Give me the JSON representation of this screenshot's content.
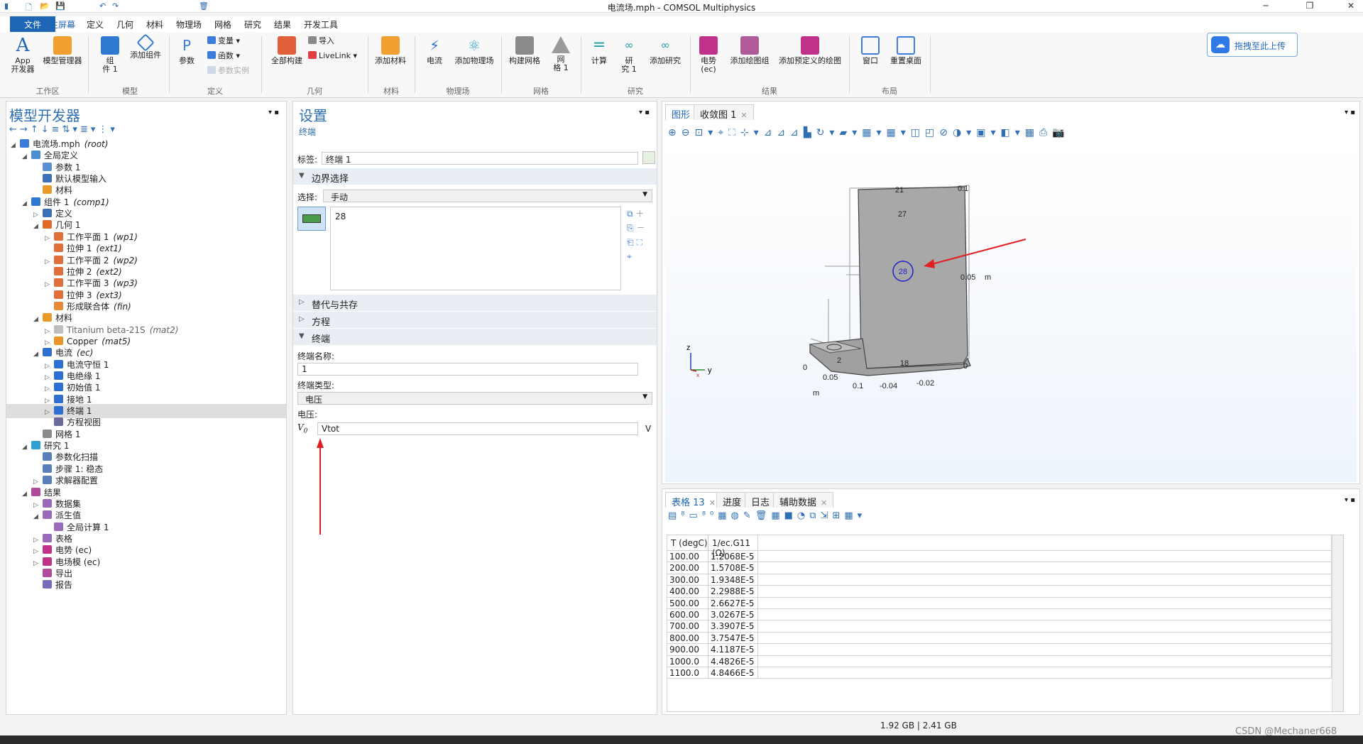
{
  "window": {
    "title": "电流场.mph - COMSOL Multiphysics"
  },
  "menubar": {
    "file": "文件",
    "items": [
      "主屏幕",
      "定义",
      "几何",
      "材料",
      "物理场",
      "网格",
      "研究",
      "结果",
      "开发工具"
    ]
  },
  "ribbon": {
    "app_dev": "App\n开发器",
    "app_dev_l1": "App",
    "app_dev_l2": "开发器",
    "model_mgr": "模型管理器",
    "component": "组",
    "component_l2": "件 1",
    "add_component": "添加组件",
    "parameters": "参数",
    "variables": "变量",
    "functions": "函数",
    "param_instance": "参数实例",
    "build_all": "全部构建",
    "import": "导入",
    "livelink": "LiveLink",
    "add_material": "添加材料",
    "current": "电流",
    "add_physics": "添加物理场",
    "build_mesh": "构建网格",
    "mesh": "网",
    "mesh_l2": "格 1",
    "compute": "计算",
    "study": "研",
    "study_l2": "究 1",
    "add_study": "添加研究",
    "potential": "电势",
    "potential_l2": "(ec)",
    "add_plot_group": "添加绘图组",
    "add_predef_plot": "添加预定义的绘图",
    "window": "窗口",
    "reset_desktop": "重置桌面",
    "groups": [
      "工作区",
      "模型",
      "定义",
      "几何",
      "材料",
      "物理场",
      "网格",
      "研究",
      "结果",
      "布局"
    ],
    "upload": "拖拽至此上传",
    "help": "?"
  },
  "model_builder": {
    "title": "模型开发器",
    "tree": [
      {
        "label": "电流场.mph",
        "tag": "(root)",
        "level": 0,
        "arrow": "◢",
        "color": "#3b7dd8"
      },
      {
        "label": "全局定义",
        "tag": "",
        "level": 1,
        "arrow": "◢",
        "color": "#4a8fd4"
      },
      {
        "label": "参数 1",
        "tag": "",
        "level": 2,
        "arrow": "",
        "color": "#5b8fd0"
      },
      {
        "label": "默认模型输入",
        "tag": "",
        "level": 2,
        "arrow": "",
        "color": "#3f6fb8"
      },
      {
        "label": "材料",
        "tag": "",
        "level": 2,
        "arrow": "",
        "color": "#e89a2a"
      },
      {
        "label": "组件 1",
        "tag": "(comp1)",
        "level": 1,
        "arrow": "◢",
        "color": "#2f7ad0"
      },
      {
        "label": "定义",
        "tag": "",
        "level": 2,
        "arrow": "▷",
        "color": "#3b6fb8"
      },
      {
        "label": "几何 1",
        "tag": "",
        "level": 2,
        "arrow": "◢",
        "color": "#e06a2a"
      },
      {
        "label": "工作平面 1",
        "tag": "(wp1)",
        "level": 3,
        "arrow": "▷",
        "color": "#e0703a"
      },
      {
        "label": "拉伸 1",
        "tag": "(ext1)",
        "level": 3,
        "arrow": "",
        "color": "#e0703a"
      },
      {
        "label": "工作平面 2",
        "tag": "(wp2)",
        "level": 3,
        "arrow": "▷",
        "color": "#e0703a"
      },
      {
        "label": "拉伸 2",
        "tag": "(ext2)",
        "level": 3,
        "arrow": "",
        "color": "#e0703a"
      },
      {
        "label": "工作平面 3",
        "tag": "(wp3)",
        "level": 3,
        "arrow": "▷",
        "color": "#e0703a"
      },
      {
        "label": "拉伸 3",
        "tag": "(ext3)",
        "level": 3,
        "arrow": "",
        "color": "#e0703a"
      },
      {
        "label": "形成联合体",
        "tag": "(fin)",
        "level": 3,
        "arrow": "",
        "color": "#e88a3a"
      },
      {
        "label": "材料",
        "tag": "",
        "level": 2,
        "arrow": "◢",
        "color": "#e89a2a"
      },
      {
        "label": "Titanium beta-21S",
        "tag": "(mat2)",
        "level": 3,
        "arrow": "▷",
        "color": "#bdbdbd",
        "gray": true
      },
      {
        "label": "Copper",
        "tag": "(mat5)",
        "level": 3,
        "arrow": "▷",
        "color": "#e8962a"
      },
      {
        "label": "电流",
        "tag": "(ec)",
        "level": 2,
        "arrow": "◢",
        "color": "#2f6fd0"
      },
      {
        "label": "电流守恒 1",
        "tag": "",
        "level": 3,
        "arrow": "▷",
        "color": "#2f6fd0"
      },
      {
        "label": "电绝缘 1",
        "tag": "",
        "level": 3,
        "arrow": "▷",
        "color": "#2f6fd0"
      },
      {
        "label": "初始值 1",
        "tag": "",
        "level": 3,
        "arrow": "▷",
        "color": "#2f6fd0"
      },
      {
        "label": "接地 1",
        "tag": "",
        "level": 3,
        "arrow": "▷",
        "color": "#2f6fd0"
      },
      {
        "label": "终端 1",
        "tag": "",
        "level": 3,
        "arrow": "▷",
        "color": "#2f6fd0",
        "selected": true
      },
      {
        "label": "方程视图",
        "tag": "",
        "level": 3,
        "arrow": "",
        "color": "#6a6a9a"
      },
      {
        "label": "网格 1",
        "tag": "",
        "level": 2,
        "arrow": "",
        "color": "#8a8a8a"
      },
      {
        "label": "研究 1",
        "tag": "",
        "level": 1,
        "arrow": "◢",
        "color": "#2fa0d0"
      },
      {
        "label": "参数化扫描",
        "tag": "",
        "level": 2,
        "arrow": "",
        "color": "#5a7fb8"
      },
      {
        "label": "步骤 1: 稳态",
        "tag": "",
        "level": 2,
        "arrow": "",
        "color": "#5a7fb8"
      },
      {
        "label": "求解器配置",
        "tag": "",
        "level": 2,
        "arrow": "▷",
        "color": "#5a7fb8"
      },
      {
        "label": "结果",
        "tag": "",
        "level": 1,
        "arrow": "◢",
        "color": "#b04a9a"
      },
      {
        "label": "数据集",
        "tag": "",
        "level": 2,
        "arrow": "▷",
        "color": "#9a6ab8"
      },
      {
        "label": "派生值",
        "tag": "",
        "level": 2,
        "arrow": "◢",
        "color": "#9a6ab8"
      },
      {
        "label": "全局计算 1",
        "tag": "",
        "level": 3,
        "arrow": "",
        "color": "#9a6ab8"
      },
      {
        "label": "表格",
        "tag": "",
        "level": 2,
        "arrow": "▷",
        "color": "#9a6ab8"
      },
      {
        "label": "电势 (ec)",
        "tag": "",
        "level": 2,
        "arrow": "▷",
        "color": "#c0328a"
      },
      {
        "label": "电场模 (ec)",
        "tag": "",
        "level": 2,
        "arrow": "▷",
        "color": "#c0328a"
      },
      {
        "label": "导出",
        "tag": "",
        "level": 2,
        "arrow": "",
        "color": "#b04a9a"
      },
      {
        "label": "报告",
        "tag": "",
        "level": 2,
        "arrow": "",
        "color": "#7a6ab8"
      }
    ]
  },
  "settings": {
    "title": "设置",
    "subtitle": "终端",
    "label_caption": "标签:",
    "label_value": "终端 1",
    "boundary_section": "边界选择",
    "selection_caption": "选择:",
    "selection_value": "手动",
    "selected_boundary": "28",
    "override_section": "替代与共存",
    "equation_section": "方程",
    "terminal_section": "终端",
    "terminal_name_caption": "终端名称:",
    "terminal_name_value": "1",
    "terminal_type_caption": "终端类型:",
    "terminal_type_value": "电压",
    "voltage_caption": "电压:",
    "v0_symbol": "V",
    "v0_sub": "0",
    "v0_value": "Vtot",
    "v0_unit": "V"
  },
  "graphics": {
    "tabs": [
      "图形",
      "收敛图 1"
    ],
    "labels": {
      "n21": "21",
      "n27": "27",
      "n28": "28",
      "n2": "2",
      "n18": "18",
      "axis_01": "0.1",
      "axis_005": "0.05",
      "m": "m",
      "axis_0": "0",
      "b0": "0",
      "b005": "0.05",
      "b01": "0.1",
      "bm004": "-0.04",
      "bm002": "-0.02",
      "bm": "m",
      "z": "z",
      "y": "y",
      "x": "x"
    }
  },
  "table_panel": {
    "tabs": [
      "表格 13",
      "进度",
      "日志",
      "辅助数据"
    ],
    "columns": [
      "T (degC)",
      "1/ec.G11 (Ω)"
    ],
    "rows": [
      [
        "100.00",
        "1.2068E-5"
      ],
      [
        "200.00",
        "1.5708E-5"
      ],
      [
        "300.00",
        "1.9348E-5"
      ],
      [
        "400.00",
        "2.2988E-5"
      ],
      [
        "500.00",
        "2.6627E-5"
      ],
      [
        "600.00",
        "3.0267E-5"
      ],
      [
        "700.00",
        "3.3907E-5"
      ],
      [
        "800.00",
        "3.7547E-5"
      ],
      [
        "900.00",
        "4.1187E-5"
      ],
      [
        "1000.0",
        "4.4826E-5"
      ],
      [
        "1100.0",
        "4.8466E-5"
      ]
    ]
  },
  "status": {
    "memory": "1.92 GB | 2.41 GB",
    "watermark": "CSDN @Mechaner668"
  },
  "colors": {
    "accent": "#1f65b5",
    "selection": "#dedede",
    "arrow_red": "#e02020",
    "boundary_blue": "#2020d0"
  }
}
